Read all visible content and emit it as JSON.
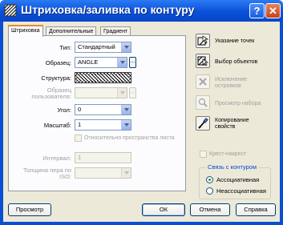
{
  "window": {
    "title": "Штриховка/заливка по контуру",
    "help_label": "?",
    "close_label": "✕"
  },
  "tabs": [
    {
      "label": "Штриховка",
      "active": true
    },
    {
      "label": "Дополнительные",
      "active": false
    },
    {
      "label": "Градиент",
      "active": false
    }
  ],
  "hatch": {
    "type_label": "Тип:",
    "type_value": "Стандартный",
    "pattern_label": "Образец:",
    "pattern_value": "ANGLE",
    "ellipsis": "...",
    "structure_label": "Структура:",
    "custom_label_1": "Образец",
    "custom_label_2": "пользователя:",
    "angle_label": "Угол:",
    "angle_value": "0",
    "scale_label": "Масштаб:",
    "scale_value": "1",
    "relative_label": "Относительно пространства листа",
    "interval_label": "Интервал:",
    "interval_value": "1",
    "pen_label_1": "Толщина пера по",
    "pen_label_2": "ISO:",
    "pen_value": ""
  },
  "actions": [
    {
      "label_1": "Указание точек",
      "label_2": "",
      "icon": "pick-points-icon",
      "enabled": true
    },
    {
      "label_1": "Выбор объектов",
      "label_2": "",
      "icon": "select-objects-icon",
      "enabled": true
    },
    {
      "label_1": "Исключение",
      "label_2": "островков",
      "icon": "remove-islands-icon",
      "enabled": false
    },
    {
      "label_1": "Просмотр набора",
      "label_2": "",
      "icon": "view-selections-icon",
      "enabled": false
    },
    {
      "label_1": "Копирование",
      "label_2": "свойств",
      "icon": "inherit-properties-icon",
      "enabled": true
    }
  ],
  "double_label": "Крест-накрест",
  "composition": {
    "title": "Связь с контуром",
    "associative": "Ассоциативная",
    "nonassociative": "Неассоциативная",
    "selected": "associative"
  },
  "buttons": {
    "preview": "Просмотр",
    "ok": "ОК",
    "cancel": "Отмена",
    "help": "Справка"
  },
  "colors": {
    "titlebar": "#0a50d8",
    "face": "#ece9d8",
    "accent": "#0046d5"
  }
}
